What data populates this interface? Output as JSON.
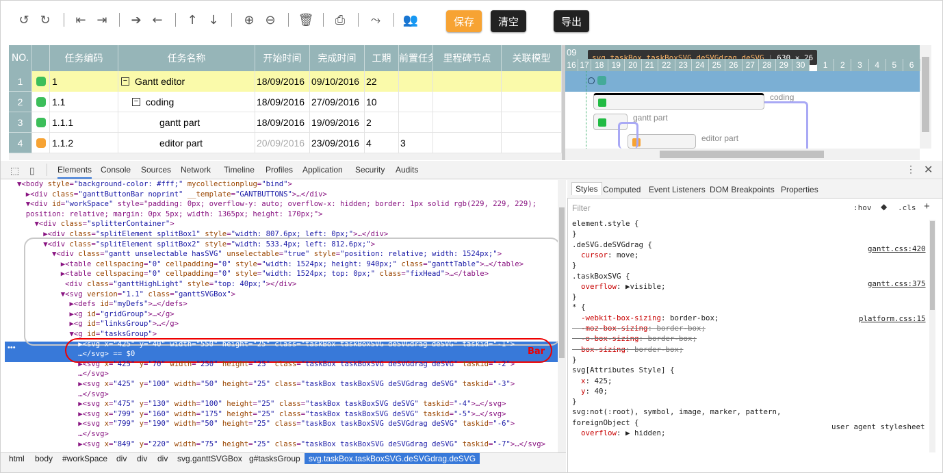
{
  "toolbar": {
    "icons": [
      "undo-icon",
      "redo-icon",
      "outdent-icon",
      "indent-icon",
      "arrow-right-icon",
      "arrow-left-icon",
      "arrow-up-icon",
      "arrow-down-icon",
      "zoom-in-icon",
      "zoom-out-icon",
      "trash-icon",
      "print-icon",
      "link-icon",
      "users-icon"
    ],
    "save": "保存",
    "clear": "清空",
    "export": "导出"
  },
  "grid": {
    "headers": [
      "NO.",
      "任务编码",
      "任务名称",
      "开始时间",
      "完成时间",
      "工期",
      "前置任务",
      "里程碑节点",
      "关联模型"
    ],
    "rows": [
      {
        "no": "1",
        "status": "green",
        "code": "1",
        "name": "Gantt editor",
        "start": "18/09/2016",
        "end": "09/10/2016",
        "dur": "22",
        "pred": "",
        "collapse": true,
        "indent": 0
      },
      {
        "no": "2",
        "status": "green",
        "code": "1.1",
        "name": "coding",
        "start": "18/09/2016",
        "end": "27/09/2016",
        "dur": "10",
        "pred": "",
        "collapse": true,
        "indent": 1
      },
      {
        "no": "3",
        "status": "green",
        "code": "1.1.1",
        "name": "gantt part",
        "start": "18/09/2016",
        "end": "19/09/2016",
        "dur": "2",
        "pred": "",
        "collapse": false,
        "indent": 2
      },
      {
        "no": "4",
        "status": "orange",
        "code": "1.1.2",
        "name": "editor part",
        "start": "20/09/2016",
        "end": "23/09/2016",
        "dur": "4",
        "pred": "3",
        "collapse": false,
        "indent": 2
      }
    ]
  },
  "gantt": {
    "month": "09",
    "days": [
      "16",
      "17",
      "18",
      "19",
      "20",
      "21",
      "22",
      "23",
      "24",
      "25",
      "26",
      "27",
      "28",
      "29",
      "30",
      "1",
      "2",
      "3",
      "4",
      "5",
      "6"
    ],
    "tooltip_sel": "svg.taskBox.taskBoxSVG.deSVGdrag.deSVG",
    "tooltip_size": "630 × 26",
    "bar_labels": [
      "coding",
      "gantt part",
      "editor part"
    ]
  },
  "devtools": {
    "tabs": [
      "Elements",
      "Console",
      "Sources",
      "Network",
      "Timeline",
      "Profiles",
      "Application",
      "Security",
      "Audits"
    ],
    "dom": [
      "▼<body style=\"background-color: #fff;\" mycollectionplug=\"bind\">",
      "  ▶<div class=\"ganttButtonBar noprint\" __template=\"GANTBUTTONS\">…</div>",
      "  ▼<div id=\"workSpace\" style=\"padding: 0px; overflow-y: auto; overflow-x: hidden; border: 1px solid rgb(229, 229, 229);",
      "  position: relative; margin: 0px 5px; width: 1365px; height: 170px;\">",
      "    ▼<div class=\"splitterContainer\">",
      "      ▶<div class=\"splitElement splitBox1\" style=\"width: 807.6px; left: 0px;\">…</div>",
      "      ▼<div class=\"splitElement splitBox2\" style=\"width: 533.4px; left: 812.6px;\">",
      "        ▼<div class=\"gantt unselectable hasSVG\" unselectable=\"true\" style=\"position: relative; width: 1524px;\">",
      "          ▶<table cellspacing=\"0\" cellpadding=\"0\" style=\"width: 1524px; height: 940px;\" class=\"ganttTable\">…</table>",
      "          ▶<table cellspacing=\"0\" cellpadding=\"0\" style=\"width: 1524px; top: 0px;\" class=\"fixHead\">…</table>",
      "           <div class=\"ganttHighLight\" style=\"top: 40px;\"></div>",
      "          ▼<svg version=\"1.1\" class=\"ganttSVGBox\">",
      "            ▶<defs id=\"myDefs\">…</defs>",
      "            ▶<g id=\"gridGroup\">…</g>",
      "            ▶<g id=\"linksGroup\">…</g>",
      "            ▼<g id=\"tasksGroup\">",
      "              ▶<svg x=\"425\" y=\"40\" width=\"550\" height=\"25\" class=\"taskBox taskBoxSVG deSVGdrag deSVG\" taskid=\"-1\">",
      "              …</svg> == $0",
      "              ▶<svg x=\"425\" y=\"70\" width=\"250\" height=\"25\" class=\"taskBox taskBoxSVG deSVGdrag deSVG\" taskid=\"-2\">",
      "              …</svg>",
      "              ▶<svg x=\"425\" y=\"100\" width=\"50\" height=\"25\" class=\"taskBox taskBoxSVG deSVGdrag deSVG\" taskid=\"-3\">",
      "              …</svg>",
      "              ▶<svg x=\"475\" y=\"130\" width=\"100\" height=\"25\" class=\"taskBox taskBoxSVG deSVG\" taskid=\"-4\">…</svg>",
      "              ▶<svg x=\"799\" y=\"160\" width=\"175\" height=\"25\" class=\"taskBox taskBoxSVG deSVG\" taskid=\"-5\">…</svg>",
      "              ▶<svg x=\"799\" y=\"190\" width=\"50\" height=\"25\" class=\"taskBox taskBoxSVG deSVGdrag deSVG\" taskid=\"-6\">",
      "              …</svg>",
      "              ▶<svg x=\"849\" y=\"220\" width=\"75\" height=\"25\" class=\"taskBox taskBoxSVG deSVGdrag deSVG\" taskid=\"-7\">…</svg>"
    ],
    "bar_annotation": "Bar",
    "side_tabs": [
      "Styles",
      "Computed",
      "Event Listeners",
      "DOM Breakpoints",
      "Properties"
    ],
    "filter": "Filter",
    "hov": ":hov",
    "cls": ".cls",
    "styles": [
      "element.style {",
      "}",
      ".deSVG.deSVGdrag {",
      "  cursor: move;",
      "}",
      ".taskBoxSVG {",
      "  overflow: ▶visible;",
      "}",
      "* {",
      "  -webkit-box-sizing: border-box;",
      "  -moz-box-sizing: border-box;",
      "  -o-box-sizing: border-box;",
      "  box-sizing: border-box;",
      "}",
      "svg[Attributes Style] {",
      "  x: 425;",
      "  y: 40;",
      "}",
      "svg:not(:root), symbol, image, marker, pattern,",
      "foreignObject {",
      "  overflow: ▶ hidden;"
    ],
    "sources": [
      "gantt.css:420",
      "gantt.css:375",
      "platform.css:15",
      "user agent stylesheet"
    ],
    "breadcrumb": [
      "html",
      "body",
      "#workSpace",
      "div",
      "div",
      "div",
      "svg.ganttSVGBox",
      "g#tasksGroup",
      "svg.taskBox.taskBoxSVG.deSVGdrag.deSVG"
    ]
  }
}
